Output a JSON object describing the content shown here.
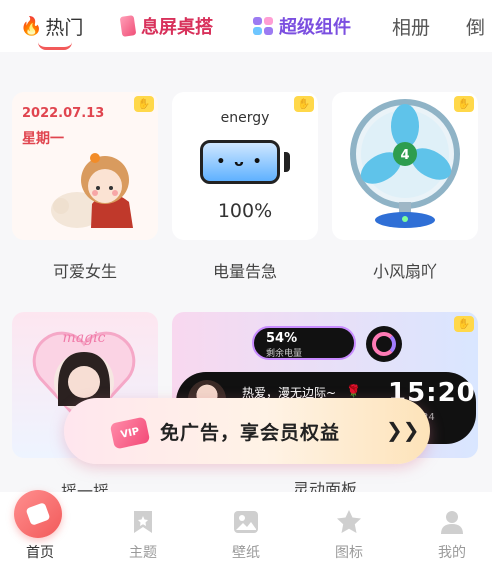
{
  "tabs": [
    {
      "label": "热门",
      "icon": "fire-icon",
      "active": true
    },
    {
      "label": "息屏桌搭",
      "icon": "lock-screen-icon"
    },
    {
      "label": "超级组件",
      "icon": "widget-icon"
    },
    {
      "label": "相册"
    },
    {
      "label": "倒"
    }
  ],
  "cards": {
    "cute_girl": {
      "date": "2022.07.13",
      "weekday": "星期一",
      "label": "可爱女生"
    },
    "battery": {
      "title": "energy",
      "face": "• ᴗ •",
      "percent": "100%",
      "label": "电量告急"
    },
    "fan": {
      "speed": "4",
      "label": "小风扇吖"
    },
    "shake": {
      "sticker": "magic",
      "label": "摇一摇"
    },
    "dynamic_panel": {
      "battery_pct": "54%",
      "battery_caption": "剩余电量",
      "song": "热爱，漫无边际~",
      "time": "15:20",
      "seconds": "24",
      "label": "灵动面板"
    }
  },
  "promo": {
    "badge": "VIP",
    "text": "免广告，享会员权益",
    "arrow": "❯❯"
  },
  "nav": [
    {
      "label": "首页",
      "icon": "home-icon",
      "active": true
    },
    {
      "label": "主题",
      "icon": "bookmark-icon"
    },
    {
      "label": "壁纸",
      "icon": "image-icon"
    },
    {
      "label": "图标",
      "icon": "star-badge-icon"
    },
    {
      "label": "我的",
      "icon": "profile-icon"
    }
  ],
  "colors": {
    "accent": "#f25a5a",
    "vip": "#f34a78",
    "widget": "#7b4fe0",
    "lock": "#d8315b"
  }
}
